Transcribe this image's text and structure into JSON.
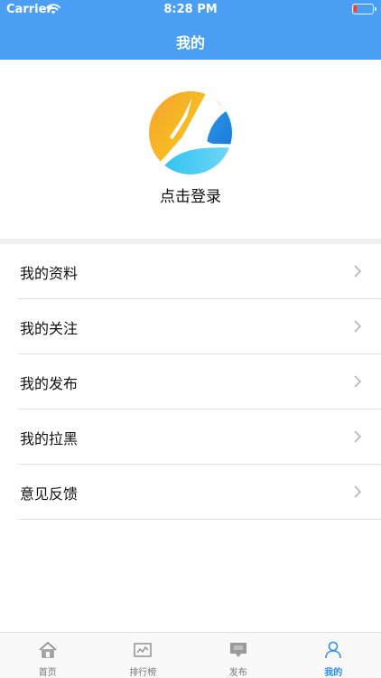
{
  "status_bar": {
    "carrier": "Carrier",
    "time": "8:28 PM"
  },
  "nav": {
    "title": "我的"
  },
  "profile": {
    "login_text": "点击登录",
    "avatar_icon": "app-logo"
  },
  "menu": [
    {
      "label": "我的资料"
    },
    {
      "label": "我的关注"
    },
    {
      "label": "我的发布"
    },
    {
      "label": "我的拉黑"
    },
    {
      "label": "意见反馈"
    }
  ],
  "tabs": [
    {
      "label": "首页",
      "icon": "home-icon",
      "active": false
    },
    {
      "label": "排行榜",
      "icon": "chart-icon",
      "active": false
    },
    {
      "label": "发布",
      "icon": "publish-icon",
      "active": false
    },
    {
      "label": "我的",
      "icon": "person-icon",
      "active": true
    }
  ],
  "colors": {
    "accent": "#4a9ff5",
    "active_tab": "#2e8ff0"
  }
}
